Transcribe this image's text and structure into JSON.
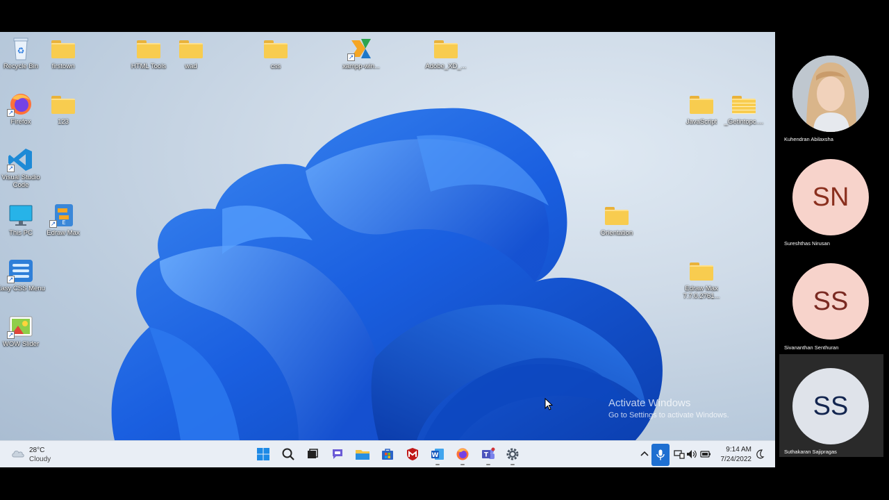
{
  "desktop_icons": [
    {
      "label": "Recycle Bin",
      "icon": "recycle-bin-icon"
    },
    {
      "label": "firstown",
      "icon": "folder-icon"
    },
    {
      "label": "HTML Tools",
      "icon": "folder-icon"
    },
    {
      "label": "wad",
      "icon": "folder-icon"
    },
    {
      "label": "css",
      "icon": "folder-icon"
    },
    {
      "label": "xampp-win...",
      "icon": "xampp-icon"
    },
    {
      "label": "Adobe_XD_...",
      "icon": "folder-icon"
    },
    {
      "label": "Firefox",
      "icon": "firefox-icon"
    },
    {
      "label": "123",
      "icon": "folder-icon"
    },
    {
      "label": "JavaScript",
      "icon": "folder-icon"
    },
    {
      "label": "_Getintopc....",
      "icon": "folder-icon"
    },
    {
      "label": "Visual Studio Code",
      "icon": "vscode-icon"
    },
    {
      "label": "This PC",
      "icon": "monitor-icon"
    },
    {
      "label": "Edraw Max",
      "icon": "edraw-icon"
    },
    {
      "label": "Orientation",
      "icon": "folder-icon"
    },
    {
      "label": "Easy CSS Menu",
      "icon": "easy-css-menu-icon"
    },
    {
      "label": "Edraw Max 7.7.0.2761...",
      "icon": "folder-icon"
    },
    {
      "label": "WOW Slider",
      "icon": "wow-slider-icon"
    }
  ],
  "watermark": {
    "line1": "Activate Windows",
    "line2": "Go to Settings to activate Windows."
  },
  "taskbar": {
    "weather": {
      "temp": "28°C",
      "condition": "Cloudy",
      "icon": "cloud-icon"
    },
    "apps": [
      "start-icon",
      "search-icon",
      "task-view-icon",
      "chat-icon",
      "file-explorer-icon",
      "store-icon",
      "mcafee-icon",
      "word-icon",
      "firefox-icon",
      "teams-icon",
      "settings-icon"
    ],
    "clock": {
      "time": "9:14 AM",
      "date": "7/24/2022"
    },
    "colors": {
      "accent": "#1e6fd1"
    }
  },
  "participants": [
    {
      "name": "Kuhendran Abilaxsha",
      "initials": "",
      "avatar": "photo"
    },
    {
      "name": "Sureshthas Nirusan",
      "initials": "SN",
      "bg": "#f7d3cb",
      "fg": "#8a2f1e"
    },
    {
      "name": "Sivananthan Senthuran",
      "initials": "SS",
      "bg": "#f7d3cb",
      "fg": "#7a2a22"
    },
    {
      "name": "Suthakaran Sajipragas",
      "initials": "SS",
      "bg": "#dfe3ea",
      "fg": "#13254f"
    }
  ]
}
